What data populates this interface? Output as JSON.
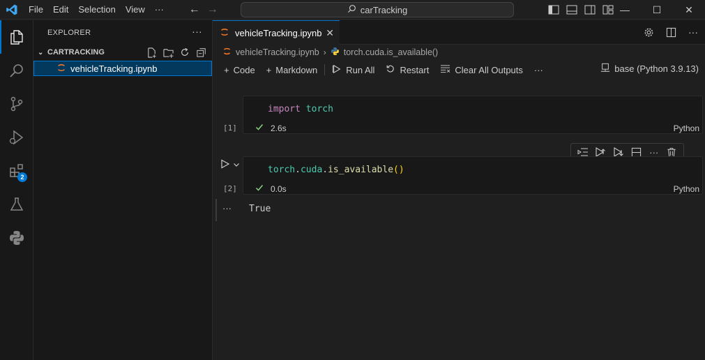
{
  "menu": {
    "file": "File",
    "edit": "Edit",
    "selection": "Selection",
    "view": "View",
    "more": "···"
  },
  "command_center": {
    "text": "carTracking"
  },
  "window": {
    "minimize": "—",
    "maximize": "☐",
    "close": "✕"
  },
  "activity": {
    "extensions_badge": "2"
  },
  "sidebar": {
    "title": "EXPLORER",
    "more": "···",
    "section": "CARTRACKING",
    "file": "vehicleTracking.ipynb"
  },
  "tab": {
    "label": "vehicleTracking.ipynb",
    "close": "✕"
  },
  "breadcrumb": {
    "file": "vehicleTracking.ipynb",
    "symbol": "torch.cuda.is_available()"
  },
  "toolbar": {
    "code": "Code",
    "markdown": "Markdown",
    "run_all": "Run All",
    "restart": "Restart",
    "clear": "Clear All Outputs",
    "more": "···",
    "kernel": "base (Python 3.9.13)"
  },
  "cells": [
    {
      "exec_count": "[1]",
      "kw": "import",
      "mod": "torch",
      "time": "2.6s",
      "lang": "Python"
    },
    {
      "exec_count": "[2]",
      "code_obj": "torch",
      "dot1": ".",
      "code_attr": "cuda",
      "dot2": ".",
      "code_fn": "is_available",
      "code_parens": "()",
      "time": "0.0s",
      "lang": "Python",
      "output_more": "···",
      "output": "True"
    }
  ],
  "colors": {
    "accent": "#0078d4",
    "keyword": "#c586c0",
    "module": "#4ec9b0",
    "function": "#dcdcaa",
    "check": "#89d185"
  }
}
